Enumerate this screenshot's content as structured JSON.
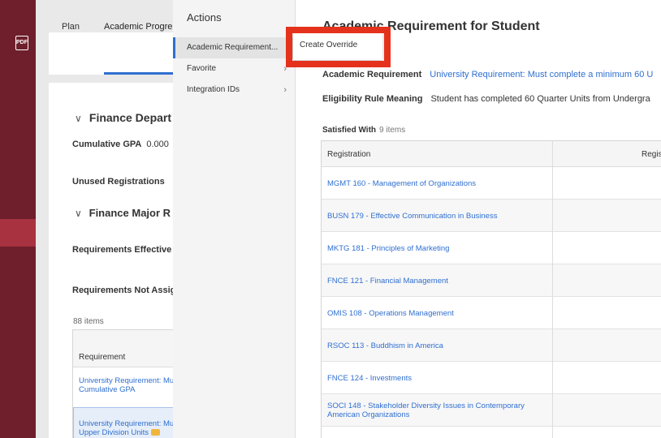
{
  "app": {
    "left_strip_icon": "pdf-icon",
    "pdf_label": "PDF"
  },
  "background": {
    "tabs": [
      {
        "label": "Plan"
      },
      {
        "label": "Academic Progre"
      }
    ],
    "section1": {
      "title": "Finance Depart"
    },
    "cumulative_gpa": {
      "label": "Cumulative GPA",
      "value": "0.000"
    },
    "unused_registrations": {
      "label": "Unused Registrations",
      "value": "("
    },
    "section2": {
      "title": "Finance Major R"
    },
    "requirements_effective": "Requirements Effective",
    "requirements_not_assigned": "Requirements Not Assig",
    "items_count": "88 items",
    "table": {
      "header": "Requirement",
      "rows": [
        {
          "line1": "University Requirement: Mu",
          "line2": "Cumulative GPA"
        },
        {
          "line1": "University Requirement: Mu",
          "line2": "Upper Division Units"
        }
      ]
    }
  },
  "actions_menu": {
    "title": "Actions",
    "items": [
      {
        "label": "Academic Requirement..."
      },
      {
        "label": "Favorite"
      },
      {
        "label": "Integration IDs"
      }
    ]
  },
  "popup": {
    "create_override": "Create Override",
    "highlight_color": "#e5321c"
  },
  "main": {
    "title": "Academic Requirement for Student",
    "academic_requirement": {
      "label": "Academic Requirement",
      "value": "University Requirement: Must complete a minimum 60 U"
    },
    "eligibility_rule": {
      "label": "Eligibility Rule Meaning",
      "value": "Student has completed 60 Quarter Units from Undergra"
    },
    "satisfied_with": {
      "label": "Satisfied With",
      "count": "9 items"
    },
    "table": {
      "headers": [
        "Registration",
        "Regis"
      ],
      "rows": [
        {
          "lines": [
            "MGMT 160 - Management of Organizations"
          ]
        },
        {
          "lines": [
            "BUSN 179 - Effective Communication in Business"
          ]
        },
        {
          "lines": [
            "MKTG 181 - Principles of Marketing"
          ]
        },
        {
          "lines": [
            "FNCE 121 - Financial Management"
          ]
        },
        {
          "lines": [
            "OMIS 108 - Operations Management"
          ]
        },
        {
          "lines": [
            "RSOC 113 - Buddhism in America"
          ]
        },
        {
          "lines": [
            "FNCE 124 - Investments"
          ]
        },
        {
          "lines": [
            "SOCI 148 - Stakeholder Diversity Issues in Contemporary",
            "American Organizations"
          ]
        }
      ]
    }
  },
  "colors": {
    "accent": "#2f6fd0",
    "strip": "#6e1f2b",
    "badge": "#f0b63c"
  }
}
